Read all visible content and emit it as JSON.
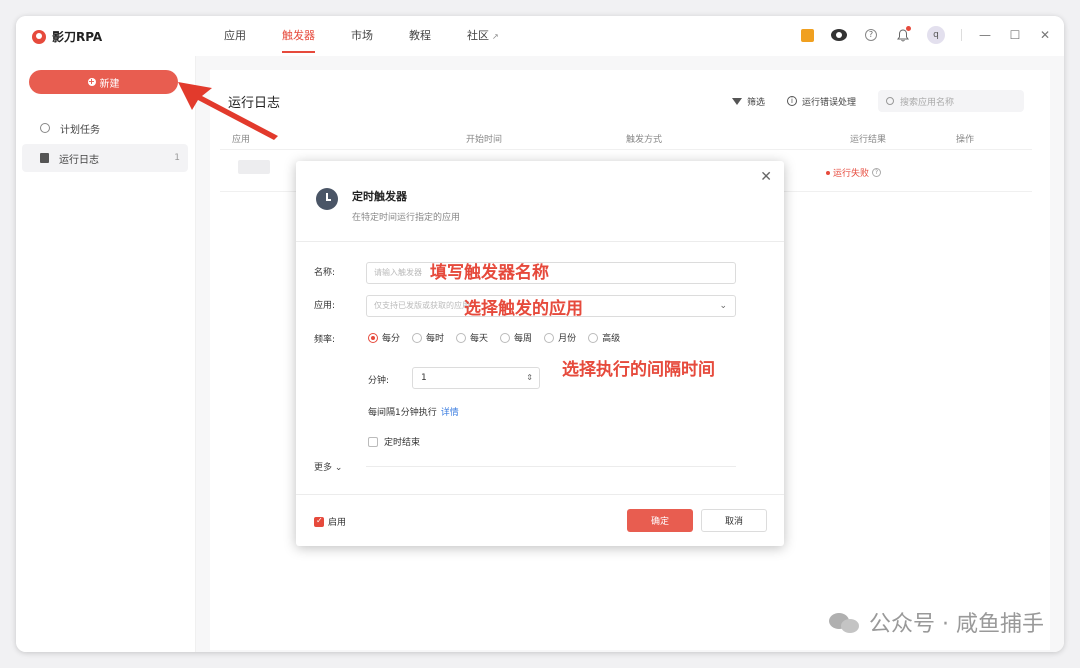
{
  "app": {
    "name": "影刀RPA"
  },
  "nav": {
    "items": [
      {
        "label": "应用"
      },
      {
        "label": "触发器"
      },
      {
        "label": "市场"
      },
      {
        "label": "教程"
      },
      {
        "label": "社区"
      }
    ],
    "ext_glyph": "↗"
  },
  "topbar": {
    "avatar_letter": "q",
    "help_glyph": "?"
  },
  "sidebar": {
    "new_button": "新建",
    "items": [
      {
        "label": "计划任务"
      },
      {
        "label": "运行日志",
        "count": "1"
      }
    ]
  },
  "main": {
    "title": "运行日志",
    "filter": "筛选",
    "error_handling": "运行错误处理",
    "search_placeholder": "搜索应用名称",
    "columns": [
      "应用",
      "开始时间",
      "触发方式",
      "运行结果",
      "操作"
    ],
    "row": {
      "result": "运行失败"
    }
  },
  "modal": {
    "title": "定时触发器",
    "subtitle": "在特定时间运行指定的应用",
    "name_label": "名称:",
    "name_placeholder": "请输入触发器",
    "app_label": "应用:",
    "app_placeholder": "仅支持已发版或获取的应用",
    "freq_label": "频率:",
    "freq_options": [
      "每分",
      "每时",
      "每天",
      "每周",
      "月份",
      "高级"
    ],
    "minute_label": "分钟:",
    "minute_value": "1",
    "interval_text": "每间隔1分钟执行",
    "detail_link": "详情",
    "end_timer": "定时结束",
    "more": "更多",
    "enable": "启用",
    "ok": "确定",
    "cancel": "取消"
  },
  "annotations": {
    "name": "填写触发器名称",
    "app": "选择触发的应用",
    "interval": "选择执行的间隔时间"
  },
  "watermark": {
    "text": "公众号 · 咸鱼捕手"
  },
  "colors": {
    "accent": "#e64a3c",
    "button": "#e85d50",
    "link": "#3b7de0"
  }
}
